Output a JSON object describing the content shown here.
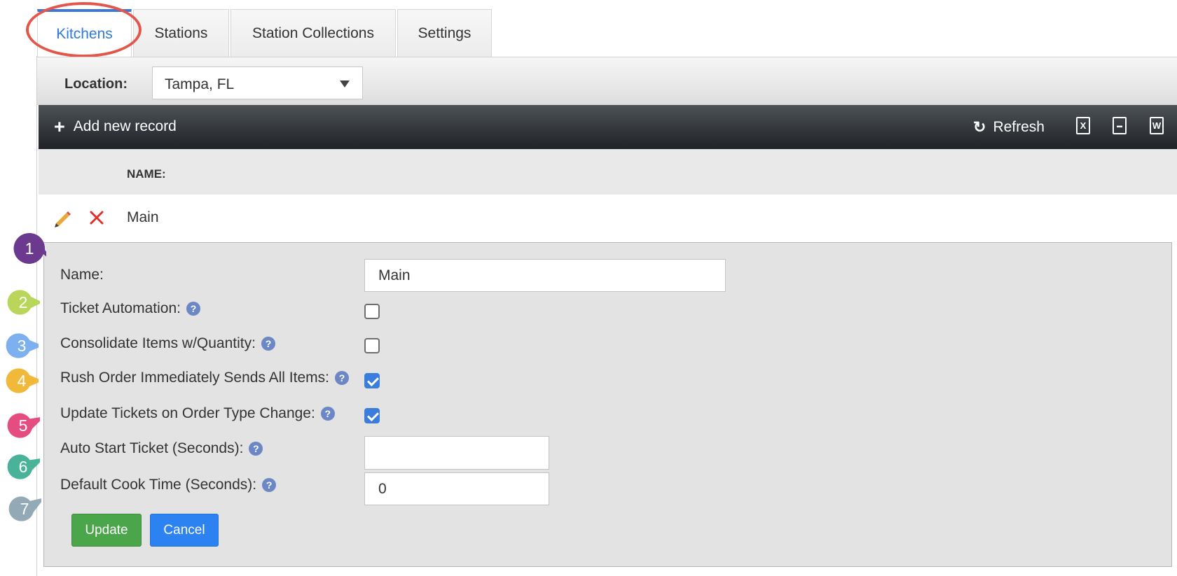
{
  "tabs": [
    "Kitchens",
    "Stations",
    "Station Collections",
    "Settings"
  ],
  "active_tab": "Kitchens",
  "location": {
    "label": "Location:",
    "value": "Tampa, FL"
  },
  "toolbar": {
    "add_label": "Add new record",
    "refresh_label": "Refresh",
    "export_icons": [
      "excel-export-icon",
      "csv-export-icon",
      "word-export-icon"
    ]
  },
  "grid": {
    "columns": [
      "NAME:"
    ],
    "rows": [
      {
        "name": "Main"
      }
    ]
  },
  "form": {
    "name_label": "Name:",
    "name_value": "Main",
    "ticket_automation_label": "Ticket Automation:",
    "ticket_automation_checked": false,
    "consolidate_label": "Consolidate Items w/Quantity:",
    "consolidate_checked": false,
    "rush_order_label": "Rush Order Immediately Sends All Items:",
    "rush_order_checked": true,
    "update_tickets_label": "Update Tickets on Order Type Change:",
    "update_tickets_checked": true,
    "auto_start_label": "Auto Start Ticket (Seconds):",
    "auto_start_value": "",
    "cook_time_label": "Default Cook Time (Seconds):",
    "cook_time_value": "0",
    "update_button": "Update",
    "cancel_button": "Cancel"
  },
  "callouts": [
    {
      "number": "1",
      "color": "#6b3a8f"
    },
    {
      "number": "2",
      "color": "#b8d659"
    },
    {
      "number": "3",
      "color": "#7db0ef"
    },
    {
      "number": "4",
      "color": "#f0b93a"
    },
    {
      "number": "5",
      "color": "#e54d81"
    },
    {
      "number": "6",
      "color": "#48b398"
    },
    {
      "number": "7",
      "color": "#93a9b6"
    }
  ],
  "colors": {
    "accent_blue": "#2f7ad8",
    "highlight_red": "#e3574b",
    "update_green": "#4ba54a",
    "cancel_blue": "#2c82f1"
  }
}
